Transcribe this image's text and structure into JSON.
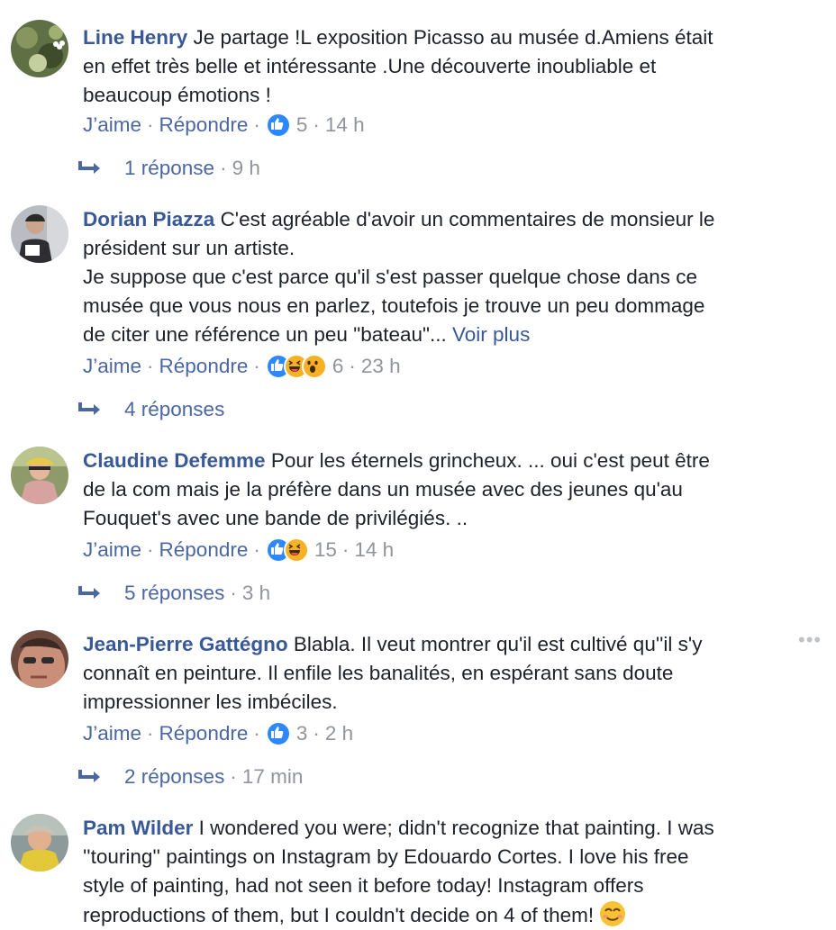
{
  "comments": [
    {
      "author": "Line Henry",
      "text": "Je partage !L exposition Picasso au musée d.Amiens était\nen effet très belle et intéressante .Une découverte inoubliable et\nbeaucoup émotions !",
      "like": "J’aime",
      "reply": "Répondre",
      "reactions": [
        "like"
      ],
      "react_count": "5",
      "time": "14 h",
      "replies_label": "1 réponse",
      "replies_time": "9 h"
    },
    {
      "author": "Dorian Piazza",
      "text": "C'est agréable d'avoir un commentaires de monsieur le\nprésident sur un artiste.\nJe suppose que c'est parce qu'il s'est passer quelque chose dans ce\nmusée que vous nous en parlez, toutefois je trouve un peu dommage\nde citer une référence un peu \"bateau\"...",
      "see_more": "Voir plus",
      "like": "J’aime",
      "reply": "Répondre",
      "reactions": [
        "like",
        "haha",
        "wow"
      ],
      "react_count": "6",
      "time": "23 h",
      "replies_label": "4 réponses"
    },
    {
      "author": "Claudine Defemme",
      "text": "Pour les éternels grincheux. ... oui c'est peut être\nde la com mais je la préfère dans un musée avec des jeunes qu'au\nFouquet's avec une bande de privilégiés. ..",
      "like": "J’aime",
      "reply": "Répondre",
      "reactions": [
        "like",
        "haha"
      ],
      "react_count": "15",
      "time": "14 h",
      "replies_label": "5 réponses",
      "replies_time": "3 h"
    },
    {
      "author": "Jean-Pierre Gattégno",
      "text": "Blabla. Il veut montrer qu'il est cultivé qu''il s'y\nconnaît en peinture. Il enfile les banalités, en espérant sans doute\nimpressionner les imbéciles.",
      "like": "J’aime",
      "reply": "Répondre",
      "reactions": [
        "like"
      ],
      "react_count": "3",
      "time": "2 h",
      "replies_label": "2 réponses",
      "replies_time": "17 min",
      "more": "•••"
    },
    {
      "author": "Pam Wilder",
      "text": "I wondered you were; didn't recognize that painting. I was\n''touring'' paintings on Instagram by Edouardo Cortes. I love his free\nstyle of painting, had not seen it before today! Instagram offers\nreproductions of them, but I couldn't decide on 4 of them!"
    }
  ],
  "separator": "·",
  "colors": {
    "link": "#385898",
    "meta": "#90949c",
    "like_blue": "#2d88ff",
    "emoji_yellow": "#f7b125"
  }
}
